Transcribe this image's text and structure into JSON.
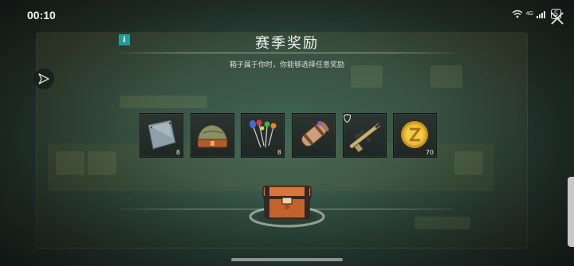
{
  "status_bar": {
    "time": "00:10",
    "network": "4G",
    "battery": "5"
  },
  "dialog": {
    "title": "赛季奖励",
    "subtitle": "箱子属于你时，你能够选择任意奖励"
  },
  "rewards": [
    {
      "icon": "metal-plate-icon",
      "quantity": "8"
    },
    {
      "icon": "tent-bag-icon",
      "quantity": ""
    },
    {
      "icon": "pins-icon",
      "quantity": "8"
    },
    {
      "icon": "bedroll-icon",
      "quantity": ""
    },
    {
      "icon": "rifle-icon",
      "quantity": ""
    },
    {
      "icon": "gold-coin-icon",
      "quantity": "70"
    }
  ],
  "colors": {
    "accent": "#1f9e96",
    "coin": "#e8b830",
    "chest": "#d9743a"
  }
}
